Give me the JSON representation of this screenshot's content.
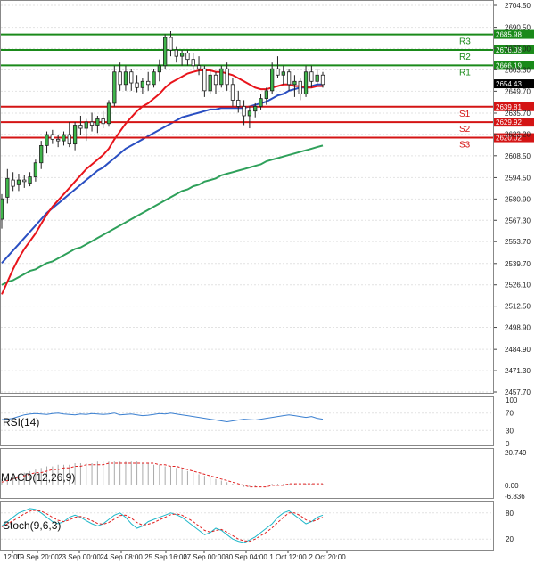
{
  "colors": {
    "background": "#ffffff",
    "grid": "#e2e2e2",
    "candle_up": "#2e9a3a",
    "candle_down": "#8b0000",
    "ma_fast": "#e8141b",
    "ma_mid": "#2a4fc2",
    "ma_slow": "#2ea05a",
    "resistance": "#1a8a1a",
    "support": "#d41414",
    "rsi": "#3a7fd0",
    "macd_hist": "#aaaaaa",
    "macd_signal": "#e02020",
    "stoch_main": "#1fb7c9",
    "stoch_signal": "#e02020"
  },
  "chart_data": {
    "type": "candlestick",
    "main_axis": {
      "ticks": [
        "2704.50",
        "2690.50",
        "2677.00",
        "2663.30",
        "2649.70",
        "2635.70",
        "2622.20",
        "2608.50",
        "2594.50",
        "2580.90",
        "2567.30",
        "2553.70",
        "2539.70",
        "2526.10",
        "2512.50",
        "2498.90",
        "2484.90",
        "2471.30",
        "2457.70"
      ],
      "ylim": [
        2457.7,
        2704.5
      ]
    },
    "x_labels": [
      "12:00",
      "19 Sep 20:00",
      "23 Sep 00:00",
      "24 Sep 08:00",
      "25 Sep 16:00",
      "27 Sep 00:00",
      "30 Sep 04:00",
      "1 Oct 12:00",
      "2 Oct 20:00"
    ],
    "levels": [
      {
        "name": "R3",
        "value": 2685.98,
        "tag": "2685.98",
        "type": "resistance"
      },
      {
        "name": "R2",
        "value": 2676.08,
        "tag": "2676.08",
        "type": "resistance"
      },
      {
        "name": "R1",
        "value": 2666.19,
        "tag": "2666.19",
        "type": "resistance"
      },
      {
        "name": "S1",
        "value": 2639.81,
        "tag": "2639.81",
        "type": "support"
      },
      {
        "name": "S2",
        "value": 2629.92,
        "tag": "2629.92",
        "type": "support"
      },
      {
        "name": "S3",
        "value": 2620.02,
        "tag": "2620.02",
        "type": "support"
      }
    ],
    "last_price": {
      "value": 2654.43,
      "tag": "2654.43"
    },
    "candles": [
      {
        "o": 2568,
        "h": 2584,
        "l": 2562,
        "c": 2581
      },
      {
        "o": 2582,
        "h": 2600,
        "l": 2578,
        "c": 2594
      },
      {
        "o": 2593,
        "h": 2598,
        "l": 2586,
        "c": 2589
      },
      {
        "o": 2590,
        "h": 2597,
        "l": 2586,
        "c": 2593
      },
      {
        "o": 2593,
        "h": 2596,
        "l": 2588,
        "c": 2592
      },
      {
        "o": 2591,
        "h": 2598,
        "l": 2589,
        "c": 2595
      },
      {
        "o": 2595,
        "h": 2606,
        "l": 2592,
        "c": 2604
      },
      {
        "o": 2604,
        "h": 2618,
        "l": 2600,
        "c": 2615
      },
      {
        "o": 2615,
        "h": 2624,
        "l": 2610,
        "c": 2622
      },
      {
        "o": 2622,
        "h": 2625,
        "l": 2616,
        "c": 2619
      },
      {
        "o": 2619,
        "h": 2622,
        "l": 2614,
        "c": 2618
      },
      {
        "o": 2618,
        "h": 2624,
        "l": 2615,
        "c": 2622
      },
      {
        "o": 2622,
        "h": 2630,
        "l": 2614,
        "c": 2616
      },
      {
        "o": 2616,
        "h": 2630,
        "l": 2612,
        "c": 2628
      },
      {
        "o": 2628,
        "h": 2634,
        "l": 2622,
        "c": 2626
      },
      {
        "o": 2626,
        "h": 2632,
        "l": 2618,
        "c": 2630
      },
      {
        "o": 2630,
        "h": 2636,
        "l": 2624,
        "c": 2628
      },
      {
        "o": 2628,
        "h": 2634,
        "l": 2623,
        "c": 2632
      },
      {
        "o": 2632,
        "h": 2637,
        "l": 2626,
        "c": 2629
      },
      {
        "o": 2629,
        "h": 2644,
        "l": 2627,
        "c": 2642
      },
      {
        "o": 2642,
        "h": 2666,
        "l": 2640,
        "c": 2662
      },
      {
        "o": 2662,
        "h": 2668,
        "l": 2650,
        "c": 2654
      },
      {
        "o": 2654,
        "h": 2666,
        "l": 2650,
        "c": 2662
      },
      {
        "o": 2662,
        "h": 2664,
        "l": 2650,
        "c": 2655
      },
      {
        "o": 2655,
        "h": 2660,
        "l": 2649,
        "c": 2652
      },
      {
        "o": 2652,
        "h": 2658,
        "l": 2648,
        "c": 2656
      },
      {
        "o": 2656,
        "h": 2662,
        "l": 2650,
        "c": 2654
      },
      {
        "o": 2654,
        "h": 2664,
        "l": 2652,
        "c": 2662
      },
      {
        "o": 2662,
        "h": 2670,
        "l": 2656,
        "c": 2666
      },
      {
        "o": 2666,
        "h": 2686,
        "l": 2664,
        "c": 2684
      },
      {
        "o": 2684,
        "h": 2688,
        "l": 2672,
        "c": 2676
      },
      {
        "o": 2676,
        "h": 2678,
        "l": 2668,
        "c": 2672
      },
      {
        "o": 2672,
        "h": 2676,
        "l": 2666,
        "c": 2674
      },
      {
        "o": 2674,
        "h": 2676,
        "l": 2666,
        "c": 2670
      },
      {
        "o": 2670,
        "h": 2674,
        "l": 2664,
        "c": 2666
      },
      {
        "o": 2666,
        "h": 2672,
        "l": 2660,
        "c": 2664
      },
      {
        "o": 2664,
        "h": 2666,
        "l": 2646,
        "c": 2650
      },
      {
        "o": 2650,
        "h": 2664,
        "l": 2648,
        "c": 2660
      },
      {
        "o": 2660,
        "h": 2662,
        "l": 2648,
        "c": 2654
      },
      {
        "o": 2654,
        "h": 2666,
        "l": 2652,
        "c": 2664
      },
      {
        "o": 2664,
        "h": 2668,
        "l": 2650,
        "c": 2654
      },
      {
        "o": 2654,
        "h": 2658,
        "l": 2640,
        "c": 2644
      },
      {
        "o": 2644,
        "h": 2650,
        "l": 2636,
        "c": 2640
      },
      {
        "o": 2640,
        "h": 2644,
        "l": 2628,
        "c": 2634
      },
      {
        "o": 2634,
        "h": 2640,
        "l": 2626,
        "c": 2637
      },
      {
        "o": 2637,
        "h": 2642,
        "l": 2633,
        "c": 2640
      },
      {
        "o": 2640,
        "h": 2648,
        "l": 2638,
        "c": 2645
      },
      {
        "o": 2645,
        "h": 2652,
        "l": 2641,
        "c": 2650
      },
      {
        "o": 2650,
        "h": 2668,
        "l": 2648,
        "c": 2664
      },
      {
        "o": 2664,
        "h": 2672,
        "l": 2658,
        "c": 2660
      },
      {
        "o": 2660,
        "h": 2666,
        "l": 2654,
        "c": 2662
      },
      {
        "o": 2662,
        "h": 2664,
        "l": 2650,
        "c": 2654
      },
      {
        "o": 2654,
        "h": 2660,
        "l": 2646,
        "c": 2656
      },
      {
        "o": 2656,
        "h": 2658,
        "l": 2644,
        "c": 2648
      },
      {
        "o": 2648,
        "h": 2666,
        "l": 2646,
        "c": 2662
      },
      {
        "o": 2662,
        "h": 2666,
        "l": 2652,
        "c": 2656
      },
      {
        "o": 2656,
        "h": 2664,
        "l": 2654,
        "c": 2660
      },
      {
        "o": 2660,
        "h": 2662,
        "l": 2652,
        "c": 2654
      }
    ],
    "ma_fast": [
      2520,
      2528,
      2536,
      2543,
      2549,
      2554,
      2559,
      2565,
      2571,
      2576,
      2580,
      2584,
      2588,
      2592,
      2596,
      2600,
      2603,
      2606,
      2609,
      2613,
      2619,
      2624,
      2629,
      2633,
      2637,
      2640,
      2642,
      2645,
      2648,
      2652,
      2655,
      2657,
      2659,
      2661,
      2662,
      2663,
      2663,
      2663,
      2662,
      2662,
      2661,
      2660,
      2658,
      2656,
      2654,
      2652,
      2651,
      2651,
      2652,
      2653,
      2654,
      2654,
      2653,
      2653,
      2652,
      2652,
      2653,
      2653
    ],
    "ma_mid": [
      2540,
      2544,
      2548,
      2552,
      2556,
      2560,
      2564,
      2568,
      2572,
      2575,
      2578,
      2581,
      2584,
      2587,
      2590,
      2593,
      2596,
      2599,
      2601,
      2604,
      2607,
      2610,
      2613,
      2615,
      2617,
      2619,
      2621,
      2623,
      2625,
      2627,
      2629,
      2631,
      2633,
      2634,
      2635,
      2636,
      2637,
      2638,
      2638,
      2639,
      2639,
      2639,
      2639,
      2639,
      2640,
      2641,
      2642,
      2643,
      2645,
      2647,
      2648,
      2650,
      2651,
      2652,
      2652,
      2653,
      2654,
      2654
    ],
    "ma_slow": [
      2526,
      2528,
      2529,
      2531,
      2533,
      2535,
      2536,
      2538,
      2540,
      2541,
      2543,
      2545,
      2547,
      2549,
      2550,
      2552,
      2554,
      2556,
      2558,
      2560,
      2562,
      2564,
      2566,
      2568,
      2570,
      2572,
      2574,
      2576,
      2578,
      2580,
      2582,
      2584,
      2586,
      2587,
      2589,
      2590,
      2592,
      2593,
      2594,
      2596,
      2597,
      2598,
      2599,
      2600,
      2601,
      2602,
      2603,
      2605,
      2606,
      2607,
      2608,
      2609,
      2610,
      2611,
      2612,
      2613,
      2614,
      2615
    ],
    "rsi": {
      "label": "RSI(14)",
      "ticks": [
        "100",
        "70",
        "30",
        "0"
      ],
      "ylim": [
        0,
        100
      ],
      "values": [
        55,
        56,
        58,
        62,
        66,
        68,
        69,
        68,
        67,
        69,
        70,
        68,
        67,
        66,
        68,
        67,
        69,
        68,
        67,
        68,
        70,
        66,
        67,
        68,
        66,
        64,
        65,
        67,
        69,
        68,
        70,
        68,
        66,
        64,
        62,
        60,
        58,
        56,
        54,
        52,
        50,
        52,
        54,
        56,
        55,
        54,
        56,
        58,
        60,
        62,
        64,
        66,
        64,
        62,
        60,
        62,
        58,
        56
      ]
    },
    "macd": {
      "label": "MACD(12,26,9)",
      "ticks": [
        "20.749",
        "0.00",
        "-6.836"
      ],
      "ylim": [
        -6.836,
        20.749
      ],
      "histogram": [
        4,
        5,
        6,
        7,
        8,
        9,
        10,
        11,
        12,
        12,
        13,
        13,
        13,
        14,
        14,
        14,
        14,
        15,
        15,
        15,
        15,
        15,
        15,
        15,
        15,
        14,
        14,
        13,
        13,
        12,
        12,
        11,
        10,
        9,
        8,
        7,
        6,
        5,
        4,
        3,
        2,
        1,
        0,
        -1,
        -1,
        -1,
        0,
        0,
        1,
        1,
        1,
        1,
        1,
        1,
        1,
        1,
        1,
        1
      ],
      "signal": [
        2,
        3,
        4,
        5,
        6,
        7,
        8,
        8,
        9,
        10,
        10,
        11,
        11,
        12,
        12,
        13,
        13,
        13,
        13,
        14,
        14,
        14,
        14,
        14,
        14,
        14,
        14,
        14,
        13,
        13,
        12,
        12,
        11,
        10,
        9,
        8,
        7,
        6,
        5,
        4,
        3,
        2,
        1,
        0,
        -1,
        -1,
        -1,
        -1,
        0,
        0,
        0,
        1,
        1,
        1,
        1,
        1,
        1,
        1
      ]
    },
    "stoch": {
      "label": "Stoch(9,6,3)",
      "ticks": [
        "80",
        "20"
      ],
      "ylim": [
        0,
        100
      ],
      "main": [
        50,
        60,
        70,
        80,
        85,
        90,
        88,
        80,
        70,
        60,
        55,
        60,
        70,
        75,
        70,
        62,
        55,
        50,
        55,
        65,
        75,
        80,
        70,
        55,
        45,
        50,
        60,
        65,
        70,
        75,
        80,
        76,
        70,
        60,
        50,
        40,
        30,
        35,
        45,
        40,
        30,
        20,
        15,
        12,
        18,
        25,
        35,
        45,
        55,
        70,
        80,
        85,
        75,
        65,
        55,
        60,
        70,
        75
      ],
      "signal": [
        48,
        55,
        62,
        70,
        78,
        84,
        86,
        84,
        78,
        70,
        63,
        60,
        64,
        70,
        72,
        68,
        62,
        56,
        54,
        58,
        66,
        74,
        75,
        68,
        58,
        52,
        54,
        58,
        64,
        70,
        76,
        78,
        75,
        68,
        60,
        50,
        40,
        36,
        40,
        42,
        36,
        28,
        20,
        16,
        15,
        20,
        28,
        36,
        46,
        58,
        70,
        80,
        80,
        74,
        64,
        60,
        64,
        70
      ]
    }
  }
}
